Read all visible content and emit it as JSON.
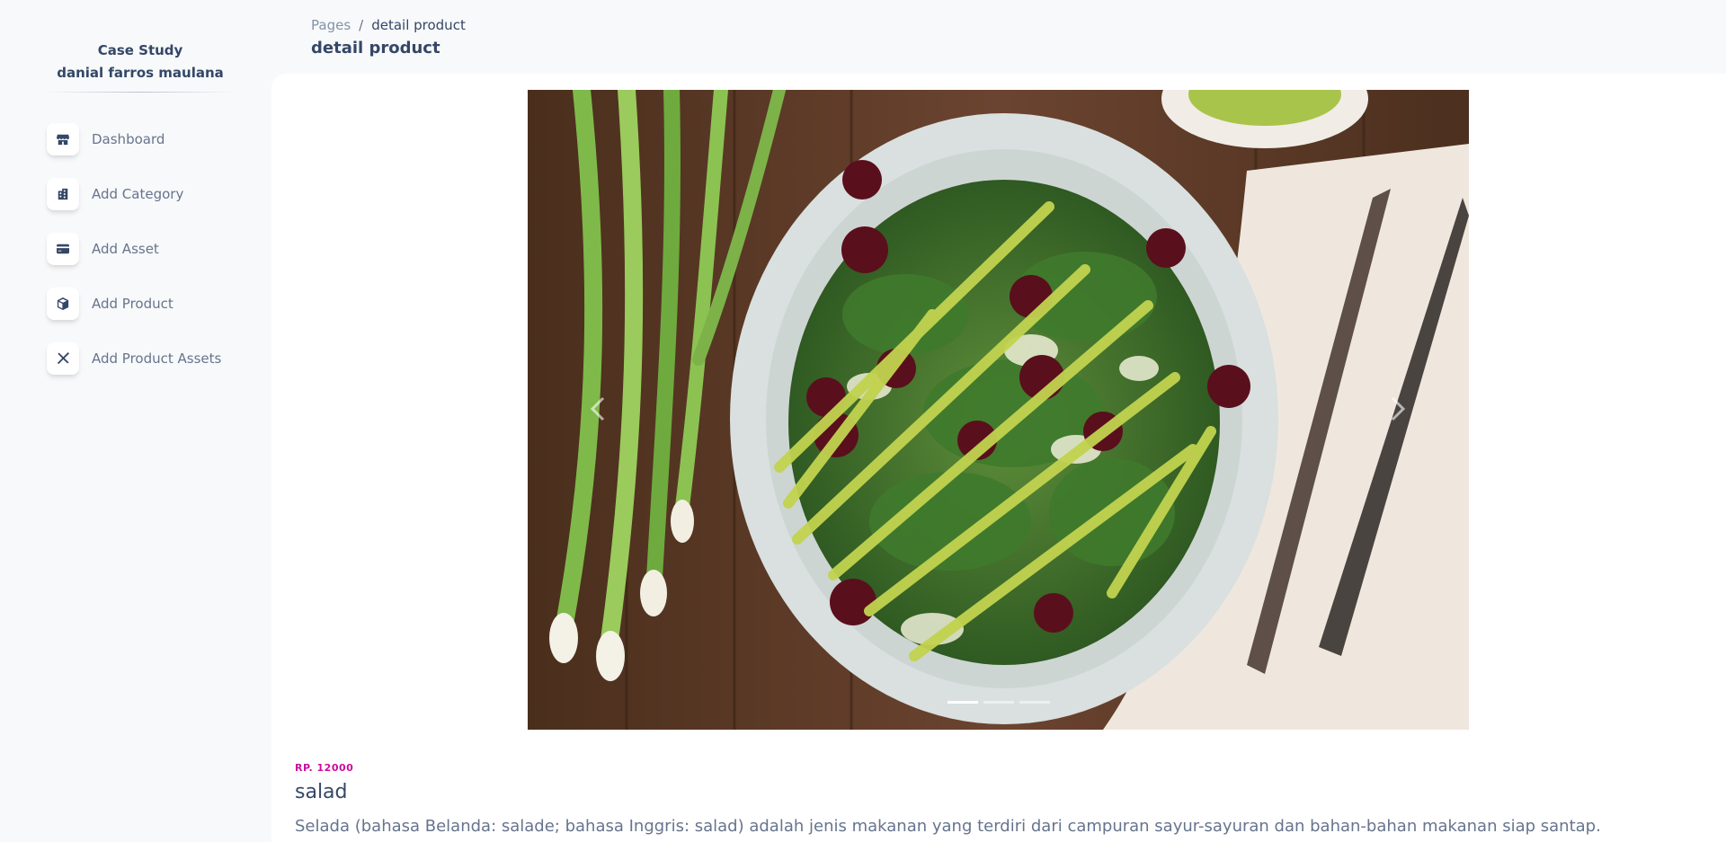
{
  "sidebar": {
    "brand_line1": "Case Study",
    "brand_line2": "danial farros maulana",
    "items": [
      {
        "label": "Dashboard",
        "icon": "shop-icon"
      },
      {
        "label": "Add Category",
        "icon": "office-icon"
      },
      {
        "label": "Add Asset",
        "icon": "credit-card-icon"
      },
      {
        "label": "Add Product",
        "icon": "box-icon"
      },
      {
        "label": "Add Product Assets",
        "icon": "tools-icon"
      }
    ]
  },
  "header": {
    "breadcrumb_parent": "Pages",
    "breadcrumb_separator": "/",
    "breadcrumb_current": "detail product",
    "title": "detail product"
  },
  "carousel": {
    "image_description": "salad photo",
    "slide_count": 3,
    "active_slide": 1
  },
  "product": {
    "price": "RP. 12000",
    "name": "salad",
    "description": "Selada (bahasa Belanda: salade; bahasa Inggris: salad) adalah jenis makanan yang terdiri dari campuran sayur-sayuran dan bahan-bahan makanan siap santap."
  },
  "colors": {
    "accent": "#cb0c9f",
    "text_primary": "#344767",
    "text_secondary": "#67748e",
    "background": "#f8f9fa"
  }
}
